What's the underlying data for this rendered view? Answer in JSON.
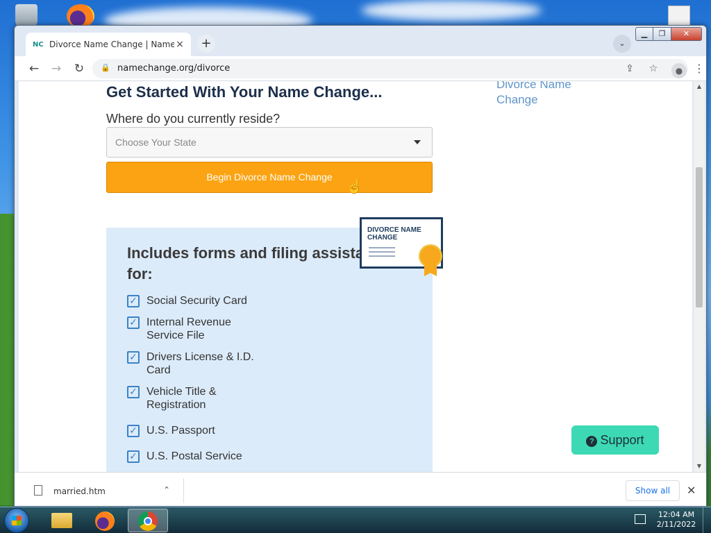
{
  "browser": {
    "tab_favicon": "NC",
    "tab_title": "Divorce Name Change | NameCh",
    "tab_close": "×",
    "new_tab": "+",
    "url": "namechange.org/divorce"
  },
  "page": {
    "heading": "Get Started With Your Name Change...",
    "side_link": "Divorce Name Change",
    "question": "Where do you currently reside?",
    "state_select": {
      "placeholder": "Choose Your State"
    },
    "begin_button": "Begin Divorce Name Change",
    "panel": {
      "title": "Includes forms and filing assista for:",
      "certificate_text": "DIVORCE NAME CHANGE",
      "features": [
        "Social Security Card",
        "Internal Revenue Service File",
        "Drivers License & I.D. Card",
        "Vehicle Title & Registration",
        "U.S. Passport",
        "U.S. Postal Service"
      ]
    },
    "support_button": "Support"
  },
  "downloads": {
    "file": "married.htm",
    "show_all": "Show all"
  },
  "taskbar": {
    "time": "12:04 AM",
    "date": "2/11/2022"
  }
}
